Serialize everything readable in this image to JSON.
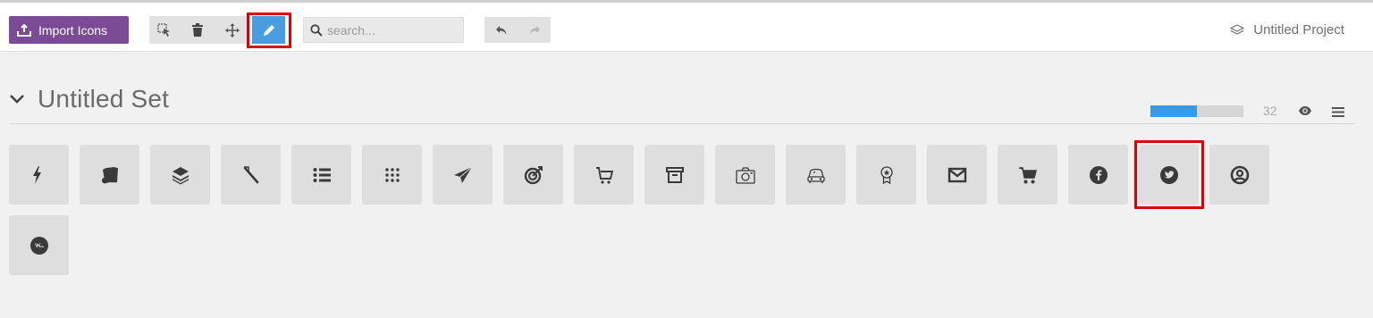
{
  "toolbar": {
    "import_label": "Import Icons",
    "search_placeholder": "search...",
    "project_name": "Untitled Project",
    "tools": [
      "select-icon",
      "trash-icon",
      "move-icon",
      "pencil-icon"
    ],
    "active_tool": "pencil-icon"
  },
  "set": {
    "title": "Untitled Set",
    "count": "32",
    "progress_fraction": 0.5
  },
  "icons": [
    "lightning-icon",
    "map-icon",
    "layers-icon",
    "toothbrush-icon",
    "list-icon",
    "grid-dots-icon",
    "paper-plane-icon",
    "target-icon",
    "cart-outline-icon",
    "archive-icon",
    "camera-icon",
    "car-icon",
    "award-icon",
    "envelope-icon",
    "shopping-cart-icon",
    "facebook-icon",
    "twitter-icon",
    "user-circle-icon",
    "vk-icon"
  ],
  "selected_icon": "twitter-icon",
  "colors": {
    "accent": "#7b4b96",
    "active": "#4a9ce0",
    "highlight": "#dd0000",
    "progress": "#3b9ae2"
  }
}
